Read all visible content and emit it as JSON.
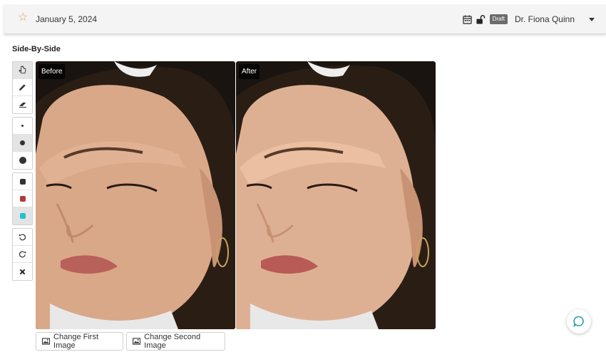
{
  "header": {
    "date": "January 5, 2024",
    "status_badge": "Draft",
    "doctor_name": "Dr. Fiona Quinn",
    "icons": [
      "star-icon",
      "calendar-icon",
      "unlock-icon",
      "chevron-down-icon"
    ]
  },
  "section": {
    "title": "Side-By-Side"
  },
  "toolbar": {
    "tools": [
      "pointer-icon",
      "pencil-icon",
      "eraser-icon"
    ],
    "sizes": [
      "small-dot",
      "medium-dot",
      "large-dot"
    ],
    "colors": [
      "#333333",
      "#b23a3a",
      "#1fc2cf"
    ],
    "actions": [
      "undo-icon",
      "redo-icon",
      "clear-icon"
    ]
  },
  "images": {
    "first_label": "Before",
    "second_label": "After"
  },
  "buttons": {
    "change_first": "Change First Image",
    "change_second": "Change Second Image"
  }
}
